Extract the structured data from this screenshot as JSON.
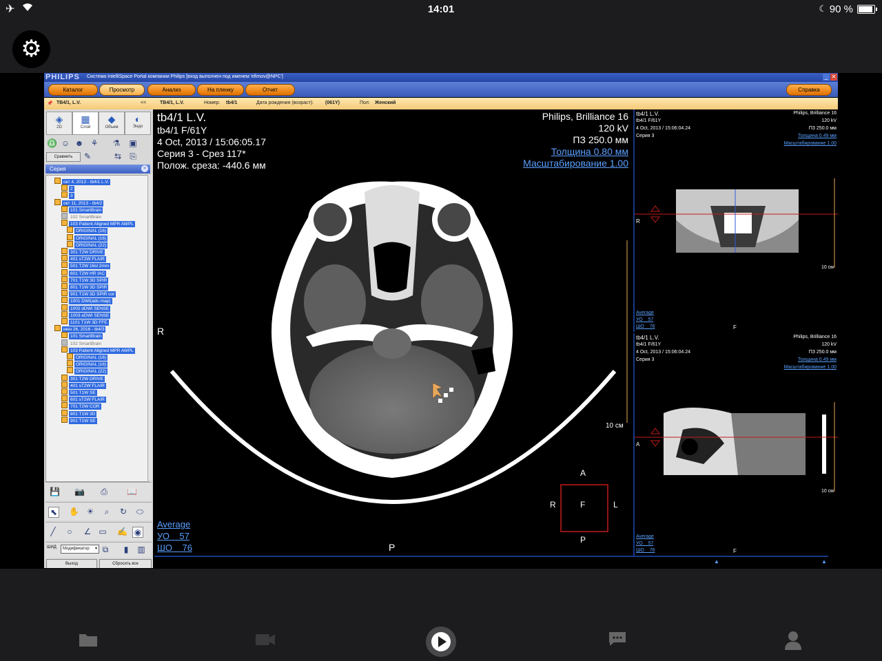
{
  "status_bar": {
    "time": "14:01",
    "battery": "90 %",
    "battery_level": 0.9
  },
  "window": {
    "logo": "PHILIPS",
    "title": "Система IntelliSpace Portal компании Philips [вход выполнен под именем 'efimov@NPC']"
  },
  "nav": {
    "buttons": [
      "Каталог",
      "Просмотр",
      "Анализ",
      "На пленку",
      "Отчет"
    ],
    "active": "Просмотр",
    "help": "Справка"
  },
  "patient_bar": {
    "short_name": "TB4/1, L.V.",
    "collapse": "<<",
    "name": "TB4/1, L.V.",
    "number_label": "Номер:",
    "number": "tb4/1",
    "dob_label": "Дата рождения (возраст):",
    "dob": "(061Y)",
    "sex_label": "Пол:",
    "sex": "Женский"
  },
  "tool_tabs": [
    {
      "label": "2D",
      "icon": "layers-icon"
    },
    {
      "label": "Слой",
      "icon": "slab-icon"
    },
    {
      "label": "Объем",
      "icon": "volume-icon"
    },
    {
      "label": "Эндо",
      "icon": "endo-icon"
    }
  ],
  "left_panel": {
    "compare": "Сравнить",
    "series_header": "Серия",
    "modifier_label": "ШИД",
    "modifier_value": "Модификатор",
    "exit": "Выход",
    "reset_all": "Сбросить все"
  },
  "series_tree": [
    {
      "level": 0,
      "label": "окт 4, 2013 - tb4/1 L.V."
    },
    {
      "level": 1,
      "label": "2"
    },
    {
      "level": 1,
      "label": "3"
    },
    {
      "level": 0,
      "label": "окт 11, 2013 - tb4/2"
    },
    {
      "level": 1,
      "label": "101 SmartBrain"
    },
    {
      "level": 1,
      "label": "102 SmartBrain",
      "gray": true
    },
    {
      "level": 1,
      "label": "103 Patient Aligned MPR AWPL"
    },
    {
      "level": 2,
      "label": "ORIGINAL (16)"
    },
    {
      "level": 2,
      "label": "ORIGINAL (16)"
    },
    {
      "level": 2,
      "label": "ORIGINAL (22)"
    },
    {
      "level": 1,
      "label": "301 T2W DRIVE"
    },
    {
      "level": 1,
      "label": "401 sT2W FLAIR"
    },
    {
      "level": 1,
      "label": "501 T2W 16sl 2mm"
    },
    {
      "level": 1,
      "label": "601 T2W HR IAC"
    },
    {
      "level": 1,
      "label": "701 T1W 3D SPIR"
    },
    {
      "level": 1,
      "label": "801 T1W 3D SPIR"
    },
    {
      "level": 1,
      "label": "901 T1W 3D SPIR cor"
    },
    {
      "level": 1,
      "label": "1001 DWI(adc-map)"
    },
    {
      "level": 1,
      "label": "1002 dDWI SENSE"
    },
    {
      "level": 1,
      "label": "1003 eDWI SENSE"
    },
    {
      "level": 1,
      "label": "1101 T1W 3D FFE"
    },
    {
      "level": 0,
      "label": "июн 26, 2016 - tb4/3"
    },
    {
      "level": 1,
      "label": "101 SmartBrain"
    },
    {
      "level": 1,
      "label": "102 SmartBrain",
      "gray": true
    },
    {
      "level": 1,
      "label": "103 Patient Aligned MPR AWPL"
    },
    {
      "level": 2,
      "label": "ORIGINAL (16)"
    },
    {
      "level": 2,
      "label": "ORIGINAL (16)"
    },
    {
      "level": 2,
      "label": "ORIGINAL (22)"
    },
    {
      "level": 1,
      "label": "301 T2W DRIVE"
    },
    {
      "level": 1,
      "label": "401 sT2W FLAIR"
    },
    {
      "level": 1,
      "label": "501 T1W SE"
    },
    {
      "level": 1,
      "label": "601 sT2W FLAIR"
    },
    {
      "level": 1,
      "label": "701 T2W COR"
    },
    {
      "level": 1,
      "label": "801 T1W 3D"
    },
    {
      "level": 1,
      "label": "901 T1W SE"
    }
  ],
  "main_view": {
    "name": "tb4/1 L.V.",
    "id_age": "tb4/1 F/61Y",
    "datetime": "4 Oct, 2013 / 15:06:05.17",
    "series": "Серия 3 - Срез 117*",
    "slice_pos": "Полож. среза: -440.6 мм",
    "scanner": "Philips, Brilliance 16",
    "kv": "120 kV",
    "fov": "ПЗ 250.0 мм",
    "thickness": "Толщина 0.80 мм",
    "zoom": "Масштабирование 1.00",
    "scale": "10 см",
    "orient_right": "R",
    "orient_bottom": "P",
    "cube": {
      "top": "A",
      "bottom": "P",
      "left": "R",
      "right": "L",
      "center": "F"
    },
    "window_name": "Average",
    "wl": "УО    57",
    "ww": "ШО    76"
  },
  "side_view_1": {
    "name": "tb4/1 L.V.",
    "id_age": "tb4/1 F/61Y",
    "datetime": "4 Oct, 2013 / 15:06:04.24",
    "series": "Серия 3",
    "scanner": "Philips, Brilliance 16",
    "kv": "120 kV",
    "fov": "ПЗ 250.0 мм",
    "thickness": "Толщина 0.49 мм",
    "zoom": "Масштабирование 1.00",
    "orient": "R",
    "bottom": "F",
    "scale": "10 см",
    "window_name": "Average",
    "wl": "УО    57",
    "ww": "ШО    76"
  },
  "side_view_2": {
    "name": "tb4/1 L.V.",
    "id_age": "tb4/1 F/61Y",
    "datetime": "4 Oct, 2013 / 15:06:04.24",
    "series": "Серия 3",
    "scanner": "Philips, Brilliance 16",
    "kv": "120 kV",
    "fov": "ПЗ 250.0 мм",
    "thickness": "Толщина 0.49 мм",
    "zoom": "Масштабирование 1.00",
    "orient": "A",
    "bottom": "F",
    "scale": "10 см",
    "window_name": "Average",
    "wl": "УО    57",
    "ww": "ШО    76"
  },
  "icons": {
    "settings": "gear-icon",
    "tabs": [
      "folder-icon",
      "video-icon",
      "play-icon",
      "chat-icon",
      "person-icon"
    ]
  }
}
